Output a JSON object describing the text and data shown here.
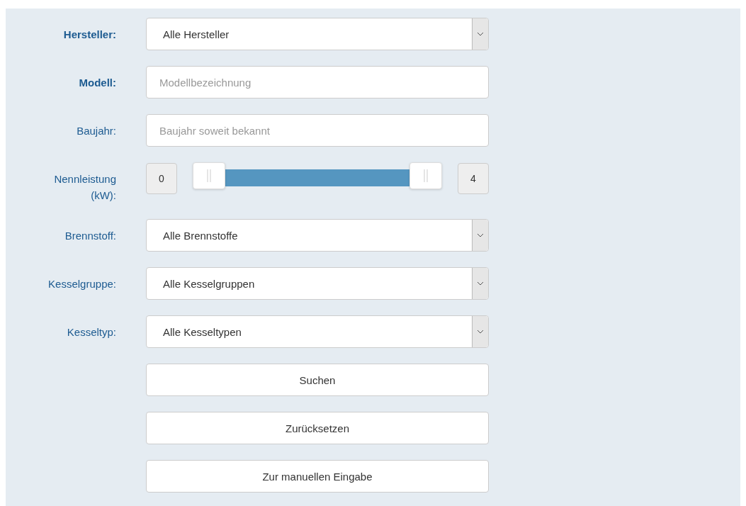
{
  "fields": [
    {
      "kind": "select",
      "label": "Hersteller:",
      "emphasized": true,
      "value": "Alle Hersteller"
    },
    {
      "kind": "text",
      "label": "Modell:",
      "emphasized": true,
      "placeholder": "Modellbezeichnung"
    },
    {
      "kind": "text",
      "label": "Baujahr:",
      "emphasized": false,
      "placeholder": "Baujahr soweit bekannt"
    },
    {
      "kind": "range",
      "label": "Nennleistung (kW):",
      "emphasized": false,
      "min_value": "0",
      "max_value": "4",
      "level": 1
    },
    {
      "kind": "select",
      "label": "Brennstoff:",
      "emphasized": false,
      "value": "Alle Brennstoffe"
    },
    {
      "kind": "select",
      "label": "Kesselgruppe:",
      "emphasized": false,
      "value": "Alle Kesselgruppen"
    },
    {
      "kind": "select",
      "label": "Kesseltyp:",
      "emphasized": false,
      "value": "Alle Kesseltypen"
    }
  ],
  "buttons": [
    "Suchen",
    "Zurücksetzen",
    "Zur manuellen Eingabe"
  ]
}
